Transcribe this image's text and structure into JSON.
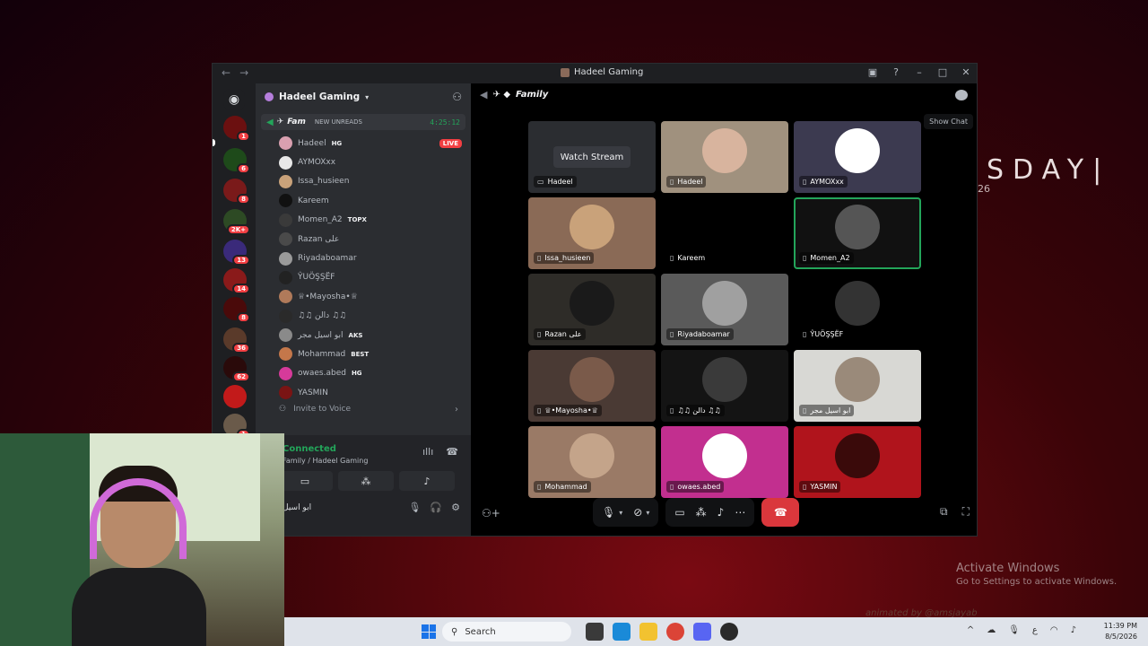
{
  "desktop": {
    "wallpaper_text": "SDAY|",
    "wallpaper_sub": "26",
    "activate_title": "Activate Windows",
    "activate_sub": "Go to Settings to activate Windows.",
    "watermark": "animated by @amsjayab"
  },
  "window": {
    "title": "Hadeel Gaming"
  },
  "server": {
    "name": "Hadeel Gaming"
  },
  "rail": {
    "badges": [
      "1",
      "6",
      "8",
      "2K+",
      "13",
      "14",
      "8",
      "36",
      "62",
      "",
      "1"
    ]
  },
  "voice_channel": {
    "name": "Fam",
    "unreads": "NEW UNREADS",
    "timer": "4:25:12"
  },
  "members": [
    {
      "name": "Hadeel",
      "tag": "HG",
      "live": "LIVE",
      "color": "#d9a0b0"
    },
    {
      "name": "AYMOXxx",
      "tag": "",
      "live": "",
      "color": "#e8e8e8"
    },
    {
      "name": "Issa_husieen",
      "tag": "",
      "live": "",
      "color": "#c9a27a"
    },
    {
      "name": "Kareem",
      "tag": "",
      "live": "",
      "color": "#111111"
    },
    {
      "name": "Momen_A2",
      "tag": "TOPX",
      "live": "",
      "color": "#3a3a3a"
    },
    {
      "name": "Razan على",
      "tag": "",
      "live": "",
      "color": "#4a4a4a"
    },
    {
      "name": "Riyadaboamar",
      "tag": "",
      "live": "",
      "color": "#9a9a9a"
    },
    {
      "name": "ŶUÖŞŞËF",
      "tag": "",
      "live": "",
      "color": "#222222"
    },
    {
      "name": "♕•Mayosha•♕",
      "tag": "",
      "live": "",
      "color": "#b07a5a"
    },
    {
      "name": "♫♫ دالن ♫♫",
      "tag": "",
      "live": "",
      "color": "#2a2a2a"
    },
    {
      "name": "ابو اسيل مجر",
      "tag": "AKS",
      "live": "",
      "color": "#8a8a8a"
    },
    {
      "name": "Mohammad",
      "tag": "BEST",
      "live": "",
      "color": "#c4774a"
    },
    {
      "name": "owaes.abed",
      "tag": "HG",
      "live": "",
      "color": "#d63a9a"
    },
    {
      "name": "YASMIN",
      "tag": "",
      "live": "",
      "color": "#7a1414"
    }
  ],
  "invite_to_voice": "Invite to Voice",
  "voice_panel": {
    "status": "Connected",
    "sub": "Family / Hadeel Gaming",
    "user": "ابو اسيل"
  },
  "stage": {
    "channel_title": "Family",
    "show_chat": "Show Chat",
    "watch_stream": "Watch Stream"
  },
  "tiles": [
    {
      "name": "Hadeel",
      "bg": "#2b2d31",
      "pic": "",
      "stream": true
    },
    {
      "name": "Hadeel",
      "bg": "#a0917e",
      "pic": "#d8b49e",
      "stream": false
    },
    {
      "name": "AYMOXxx",
      "bg": "#3c3a50",
      "pic": "#ffffff",
      "stream": false
    },
    {
      "name": "Issa_husieen",
      "bg": "#8a6a56",
      "pic": "#c9a27a",
      "stream": false
    },
    {
      "name": "Kareem",
      "bg": "#000000",
      "pic": "",
      "stream": false
    },
    {
      "name": "Momen_A2",
      "bg": "#111111",
      "pic": "#555555",
      "stream": false
    },
    {
      "name": "Razan على",
      "bg": "#2e2c28",
      "pic": "#1a1a1a",
      "stream": false
    },
    {
      "name": "Riyadaboamar",
      "bg": "#5a5a5a",
      "pic": "#a0a0a0",
      "stream": false
    },
    {
      "name": "ŶUÖŞŞËF",
      "bg": "#000000",
      "pic": "#333333",
      "stream": false
    },
    {
      "name": "♕•Mayosha•♕",
      "bg": "#4a3a34",
      "pic": "#7a5a4a",
      "stream": false
    },
    {
      "name": "♫♫ دالن ♫♫",
      "bg": "#141414",
      "pic": "#3a3a3a",
      "stream": false
    },
    {
      "name": "ابو اسيل مجر",
      "bg": "#d8d8d4",
      "pic": "#9a8a7a",
      "stream": false
    },
    {
      "name": "Mohammad",
      "bg": "#9a7a66",
      "pic": "#c4a48a",
      "stream": false
    },
    {
      "name": "owaes.abed",
      "bg": "#c22f8f",
      "pic": "#ffffff",
      "stream": false
    },
    {
      "name": "YASMIN",
      "bg": "#b0141c",
      "pic": "#3a0a0a",
      "stream": false
    }
  ],
  "taskbar": {
    "search_placeholder": "Search",
    "time": "11:39 PM",
    "date": "8/5/2026"
  },
  "colors": {
    "accent_green": "#23a55a",
    "live_red": "#f23f43",
    "hangup_red": "#da373c"
  }
}
